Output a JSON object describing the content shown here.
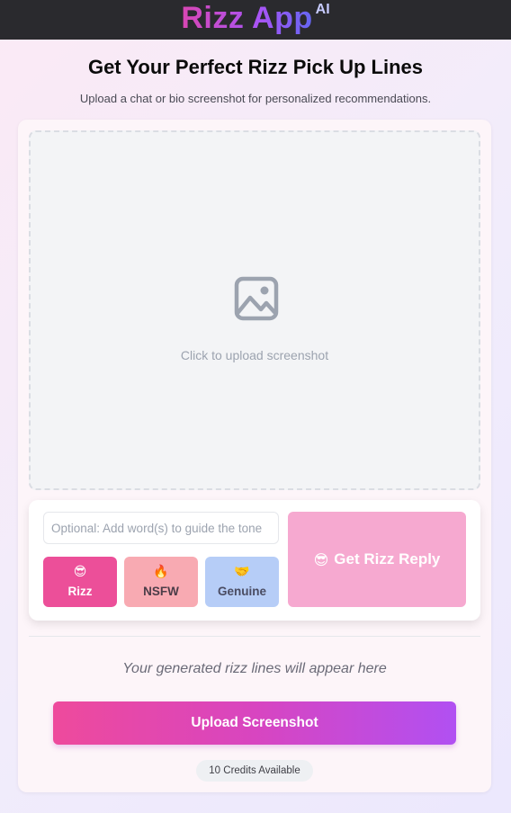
{
  "header": {
    "brand_name": "Rizz App",
    "brand_superscript": "AI"
  },
  "hero": {
    "title": "Get Your Perfect Rizz Pick Up Lines",
    "subtitle": "Upload a chat or bio screenshot for personalized recommendations."
  },
  "upload_area": {
    "icon": "image-icon",
    "prompt": "Click to upload screenshot"
  },
  "controls": {
    "tone_input_placeholder": "Optional: Add word(s) to guide the tone",
    "tone_input_value": "",
    "tones": [
      {
        "emoji": "😎",
        "label": "Rizz",
        "selected": true,
        "color": "#ec4f99"
      },
      {
        "emoji": "🔥",
        "label": "NSFW",
        "selected": false,
        "color": "#f8aab2"
      },
      {
        "emoji": "🤝",
        "label": "Genuine",
        "selected": false,
        "color": "#b6cdf7"
      }
    ],
    "get_reply": {
      "emoji": "😎",
      "label": "Get Rizz Reply",
      "color": "#f6a9d0"
    }
  },
  "results": {
    "placeholder": "Your generated rizz lines will appear here"
  },
  "upload_button": {
    "label": "Upload Screenshot"
  },
  "credits": {
    "text": "10 Credits Available"
  }
}
